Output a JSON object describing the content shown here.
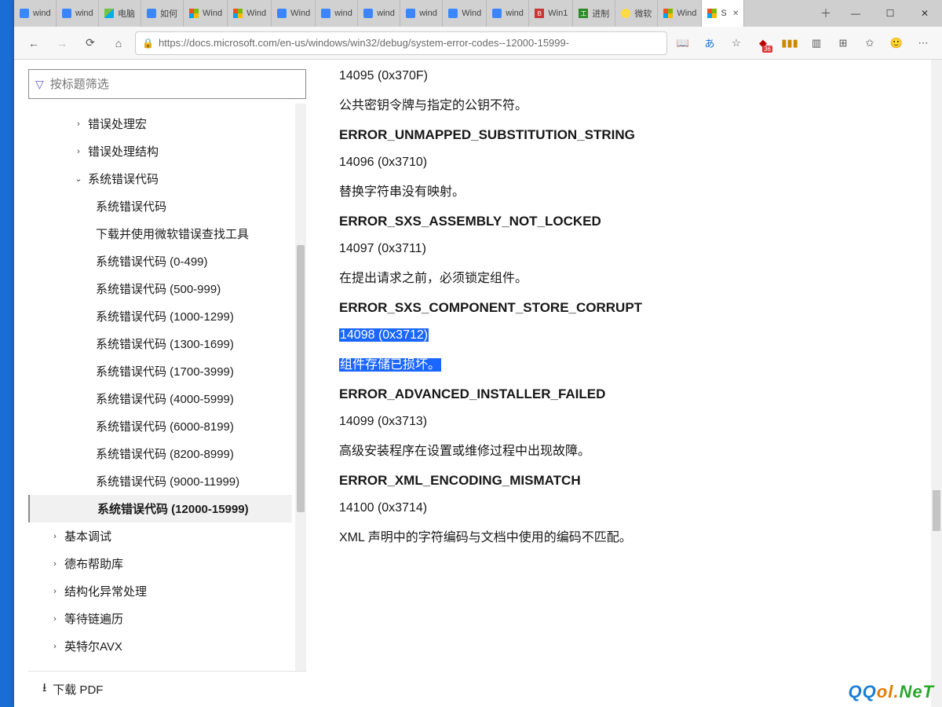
{
  "browser": {
    "tabs": [
      {
        "label": "wind",
        "favicon": "baidu"
      },
      {
        "label": "wind",
        "favicon": "baidu"
      },
      {
        "label": "电脑",
        "favicon": "win7"
      },
      {
        "label": "如何",
        "favicon": "baidu"
      },
      {
        "label": "Wind",
        "favicon": "ms"
      },
      {
        "label": "Wind",
        "favicon": "ms"
      },
      {
        "label": "Wind",
        "favicon": "baidu"
      },
      {
        "label": "wind",
        "favicon": "baidu"
      },
      {
        "label": "wind",
        "favicon": "baidu"
      },
      {
        "label": "wind",
        "favicon": "baidu"
      },
      {
        "label": "Wind",
        "favicon": "baidu"
      },
      {
        "label": "wind",
        "favicon": "baidu"
      },
      {
        "label": "Win1",
        "favicon": "jb"
      },
      {
        "label": "进制",
        "favicon": "green"
      },
      {
        "label": "微软",
        "favicon": "ss"
      },
      {
        "label": "Wind",
        "favicon": "ms"
      },
      {
        "label": "S",
        "favicon": "ms",
        "active": true
      }
    ],
    "url": "https://docs.microsoft.com/en-us/windows/win32/debug/system-error-codes--12000-15999-",
    "ext_badge": "36"
  },
  "sidebar": {
    "filter_placeholder": "按标题筛选",
    "download_pdf": "下载 PDF",
    "items": [
      {
        "label": "错误处理宏",
        "level": 1,
        "chev": "›"
      },
      {
        "label": "错误处理结构",
        "level": 1,
        "chev": "›"
      },
      {
        "label": "系统错误代码",
        "level": 1,
        "chev": "⌄",
        "expanded": true
      },
      {
        "label": "系统错误代码",
        "level": 3
      },
      {
        "label": "下载并使用微软错误查找工具",
        "level": 3
      },
      {
        "label": "系统错误代码   (0-499)",
        "level": 3
      },
      {
        "label": "系统错误代码   (500-999)",
        "level": 3
      },
      {
        "label": "系统错误代码   (1000-1299)",
        "level": 3
      },
      {
        "label": "系统错误代码   (1300-1699)",
        "level": 3
      },
      {
        "label": "系统错误代码   (1700-3999)",
        "level": 3
      },
      {
        "label": "系统错误代码   (4000-5999)",
        "level": 3
      },
      {
        "label": "系统错误代码   (6000-8199)",
        "level": 3
      },
      {
        "label": "系统错误代码   (8200-8999)",
        "level": 3
      },
      {
        "label": "系统错误代码   (9000-11999)",
        "level": 3
      },
      {
        "label": "系统错误代码   (12000-15999)",
        "level": 3,
        "selected": true
      },
      {
        "label": "基本调试",
        "level": 0,
        "chev": "›"
      },
      {
        "label": "德布帮助库",
        "level": 0,
        "chev": "›"
      },
      {
        "label": "结构化异常处理",
        "level": 0,
        "chev": "›"
      },
      {
        "label": "等待链遍历",
        "level": 0,
        "chev": "›"
      },
      {
        "label": "英特尔AVX",
        "level": 0,
        "chev": "›"
      }
    ]
  },
  "article": {
    "entries": [
      {
        "name": "",
        "code": "14095 (0x370F)",
        "desc": "公共密钥令牌与指定的公钥不符。"
      },
      {
        "name": "ERROR_UNMAPPED_SUBSTITUTION_STRING",
        "code": "14096 (0x3710)",
        "desc": "替换字符串没有映射。"
      },
      {
        "name": "ERROR_SXS_ASSEMBLY_NOT_LOCKED",
        "code": "14097 (0x3711)",
        "desc": "在提出请求之前，必须锁定组件。"
      },
      {
        "name": "ERROR_SXS_COMPONENT_STORE_CORRUPT",
        "code": "14098 (0x3712)",
        "desc": "组件存储已损坏。",
        "highlighted": true
      },
      {
        "name": "ERROR_ADVANCED_INSTALLER_FAILED",
        "code": "14099 (0x3713)",
        "desc": "高级安装程序在设置或维修过程中出现故障。"
      },
      {
        "name": "ERROR_XML_ENCODING_MISMATCH",
        "code": "14100 (0x3714)",
        "desc": "XML 声明中的字符编码与文档中使用的编码不匹配。"
      }
    ]
  },
  "watermark": {
    "a": "QQ",
    "b": "ol.",
    "c": "NeT"
  }
}
